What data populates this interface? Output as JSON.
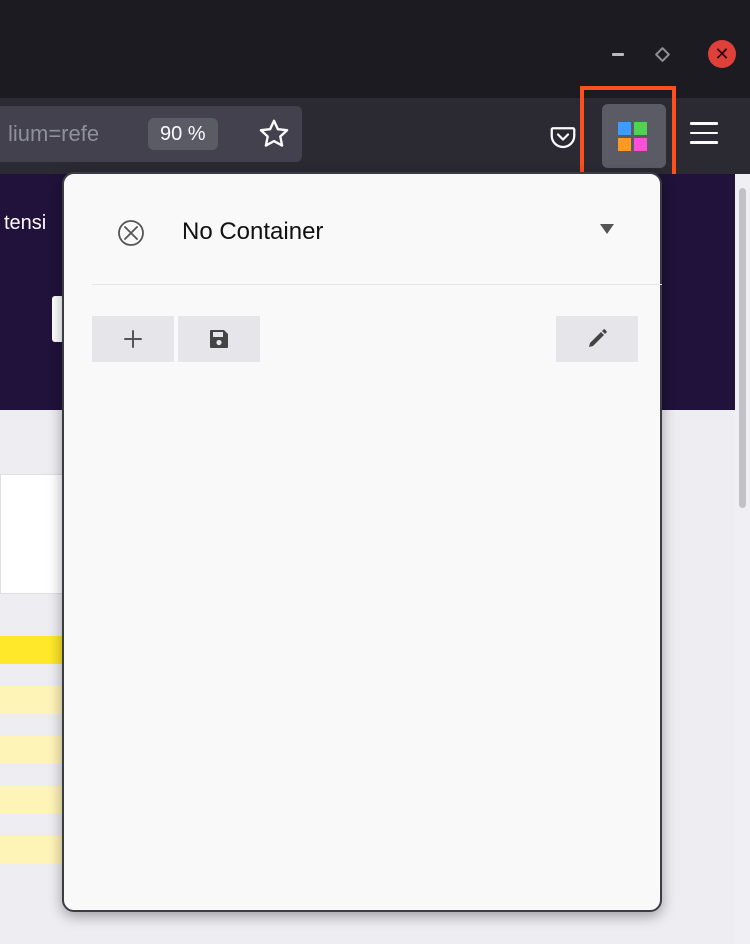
{
  "window": {
    "controls": [
      "minimize-icon",
      "restore-icon",
      "close-icon"
    ],
    "close_glyph": "✕"
  },
  "toolbar": {
    "url_fragment": "lium=refe",
    "zoom": "90 %",
    "icons": [
      "star-icon",
      "pocket-icon",
      "containers-extension-icon",
      "menu-icon"
    ]
  },
  "page": {
    "peek_text": "tensi"
  },
  "popup": {
    "container_label": "No Container",
    "container_icon": "no-container-icon",
    "dropdown_icon": "caret-down-icon",
    "actions": [
      "add-icon",
      "save-icon",
      "edit-icon"
    ]
  },
  "colors": {
    "highlight": "#ff4f1f",
    "ext_blue": "#3d9cff",
    "ext_green": "#4ed44e",
    "ext_orange": "#ff9a1e",
    "ext_pink": "#ff4fd8",
    "page_purple": "#20123a",
    "page_yellow": "#ffe82a",
    "page_light_yellow": "#fff4b8"
  }
}
